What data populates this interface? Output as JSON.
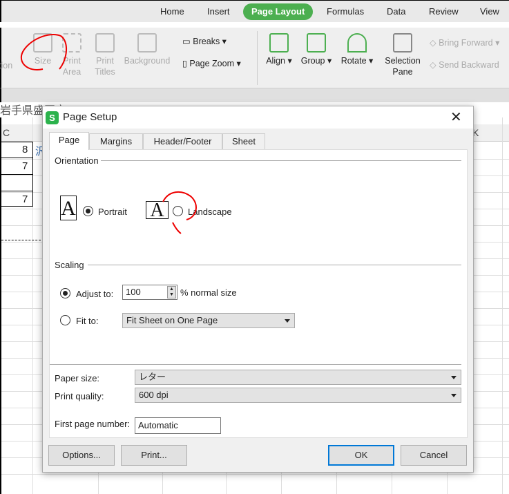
{
  "menu": {
    "tabs": [
      "Home",
      "Insert",
      "Page Layout",
      "Formulas",
      "Data",
      "Review",
      "View"
    ],
    "active": "Page Layout",
    "accent": "#4caf50"
  },
  "ribbon": {
    "orientation_partial": "tion",
    "size": "Size",
    "print_area": [
      "Print",
      "Area"
    ],
    "print_titles": [
      "Print",
      "Titles"
    ],
    "background": "Background",
    "breaks": "Breaks",
    "page_zoom": "Page Zoom",
    "align": "Align",
    "group": "Group",
    "rotate": "Rotate",
    "selection_pane": [
      "Selection",
      "Pane"
    ],
    "bring_forward": "Bring Forward",
    "send_backward": "Send Backward"
  },
  "sheet": {
    "cell_text": "岩手県盛岡市",
    "col_c": "C",
    "col_k": "K",
    "values": [
      "8",
      "7",
      "",
      "7"
    ],
    "side_text": "沢"
  },
  "dialog": {
    "title": "Page Setup",
    "tabs": [
      "Page",
      "Margins",
      "Header/Footer",
      "Sheet"
    ],
    "active_tab": "Page",
    "orientation": {
      "label": "Orientation",
      "portrait": "Portrait",
      "landscape": "Landscape",
      "selected": "Portrait",
      "icon_letter": "A"
    },
    "scaling": {
      "label": "Scaling",
      "adjust_to": "Adjust to:",
      "adjust_value": "100",
      "adjust_suffix": "% normal size",
      "fit_to": "Fit to:",
      "fit_value": "Fit Sheet on One Page",
      "selected": "Adjust to"
    },
    "paper_size": {
      "label": "Paper size:",
      "value": "レター"
    },
    "print_quality": {
      "label": "Print quality:",
      "value": "600 dpi"
    },
    "first_page_number": {
      "label": "First page number:",
      "value": "Automatic"
    },
    "buttons": {
      "options": "Options...",
      "print": "Print...",
      "ok": "OK",
      "cancel": "Cancel"
    }
  }
}
